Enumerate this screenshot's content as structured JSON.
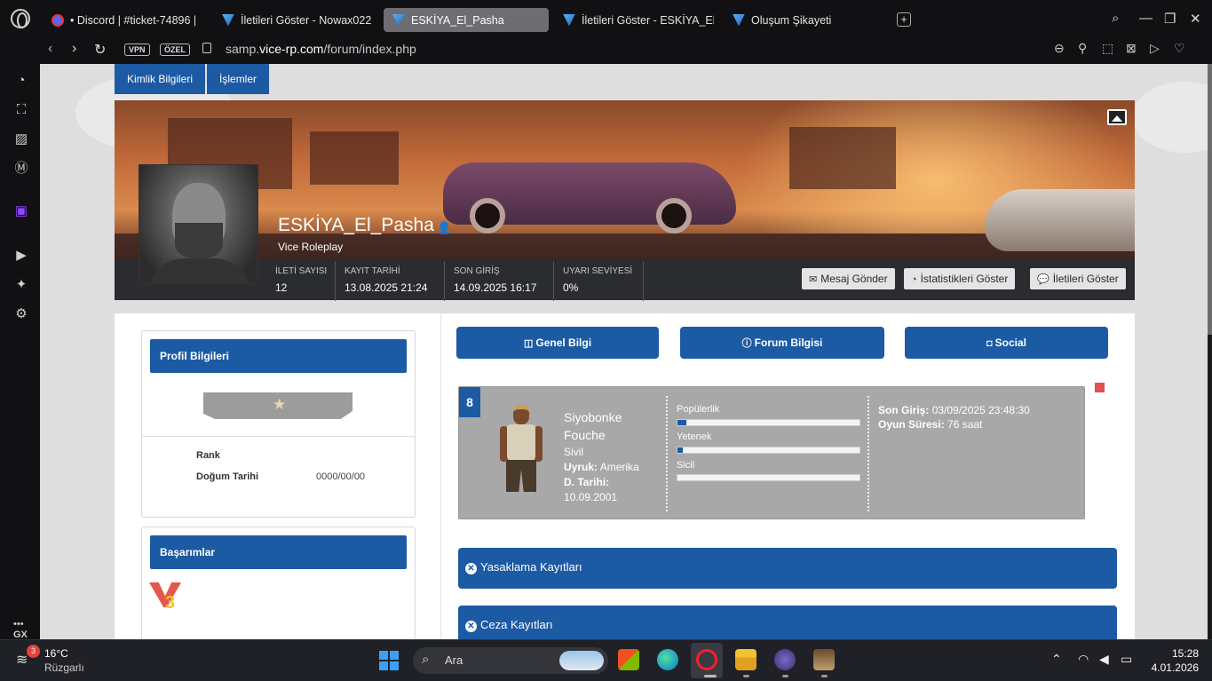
{
  "browser": {
    "tabs": [
      {
        "title": "• Discord | #ticket-74896 |",
        "active": false,
        "favicon": "discord-icon"
      },
      {
        "title": "İletileri Göster - Nowax022",
        "active": false,
        "favicon": "vice-icon"
      },
      {
        "title": "ESKİYA_El_Pasha",
        "active": true,
        "favicon": "vice-icon"
      },
      {
        "title": "İletileri Göster - ESKİYA_El_",
        "active": false,
        "favicon": "vice-icon"
      },
      {
        "title": "Oluşum Şikayeti",
        "active": false,
        "favicon": "vice-icon"
      }
    ],
    "new_tab": "+",
    "vpn_label": "VPN",
    "ozel_label": "ÖZEL",
    "url_prefix": "samp.",
    "url_domain": "vice-rp.com",
    "url_path": "/forum/index.php"
  },
  "sidebar": {
    "gx_label": "GX",
    "more_label": "•••"
  },
  "page": {
    "top_nav": [
      "Kimlik Bilgileri",
      "İşlemler"
    ],
    "profile": {
      "username": "ESKİYA_El_Pasha",
      "server": "Vice Roleplay",
      "stats": [
        {
          "label": "İLETİ SAYISI",
          "value": "12"
        },
        {
          "label": "KAYIT TARİHİ",
          "value": "13.08.2025 21:24"
        },
        {
          "label": "SON GİRİŞ",
          "value": "14.09.2025 16:17"
        },
        {
          "label": "UYARI SEVİYESİ",
          "value": "0%"
        }
      ],
      "actions": [
        "Mesaj Gönder",
        "İstatistikleri Göster",
        "İletileri Göster"
      ]
    },
    "profile_card": {
      "title": "Profil Bilgileri",
      "rank_label": "Rank",
      "birthdate_label": "Doğum Tarihi",
      "birthdate_value": "0000/00/00"
    },
    "achievements_card": {
      "title": "Başarımlar",
      "badge_number": "3"
    },
    "tab_buttons": [
      "Genel Bilgi",
      "Forum Bilgisi",
      "Social"
    ],
    "character": {
      "number": "8",
      "first_name": "Siyobonke",
      "last_name": "Fouche",
      "job": "Sivil",
      "nationality_label": "Uyruk:",
      "nationality_value": "Amerika",
      "birthdate_label": "D. Tarihi:",
      "birthdate_value": "10.09.2001",
      "bars": [
        {
          "label": "Popülerlik",
          "value": 0.05
        },
        {
          "label": "Yetenek",
          "value": 0.03
        },
        {
          "label": "Sicil",
          "value": 0.0
        }
      ],
      "last_login_label": "Son Giriş:",
      "last_login_value": "03/09/2025 23:48:30",
      "playtime_label": "Oyun Süresi:",
      "playtime_value": "76 saat"
    },
    "accordions": [
      "Yasaklama Kayıtları",
      "Ceza Kayıtları"
    ]
  },
  "taskbar": {
    "weather_badge": "3",
    "temperature": "16°C",
    "condition": "Rüzgarlı",
    "search_placeholder": "Ara",
    "time": "15:28",
    "date": "4.01.2026"
  },
  "colors": {
    "accent_blue": "#1c5aa4",
    "char_card_bg": "#a8a8a8",
    "taskbar_bg": "#202126"
  }
}
